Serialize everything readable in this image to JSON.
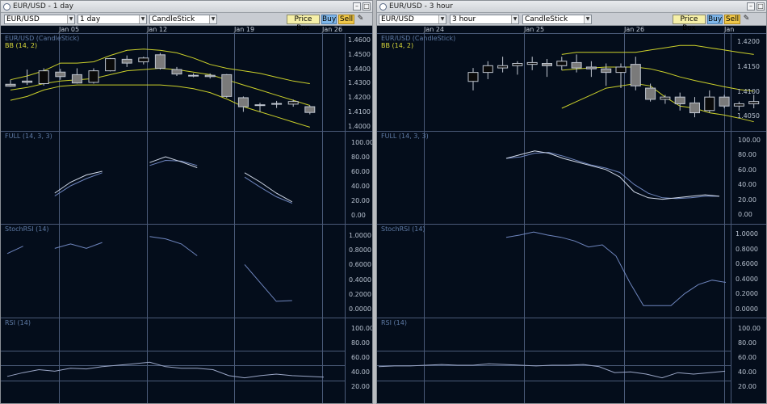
{
  "colors": {
    "bg": "#040d1b",
    "grid": "#4a5a78",
    "bb": "#cbd02a",
    "stoch_k": "#d0d8e8",
    "stoch_d": "#6f86bf",
    "rsi": "#9aa6c6",
    "bull": "#0a0a0a",
    "bear": "#7a7a7a",
    "wick": "#c0c6d0"
  },
  "left": {
    "title": "EUR/USD - 1 day",
    "symbol": "EUR/USD",
    "interval": "1 day",
    "chart_type": "CandleStick",
    "buttons": {
      "pricebox": "Price Box",
      "buy": "Buy",
      "sell": "Sell"
    },
    "dates": [
      "Jan 05",
      "Jan 12",
      "Jan 19",
      "Jan 26"
    ],
    "price_label": "EUR/USD (CandleStick)",
    "bb_label": "BB (14, 2)",
    "price_ticks": [
      "1.4600",
      "1.4500",
      "1.4400",
      "1.4300",
      "1.4200",
      "1.4100",
      "1.4000"
    ],
    "full_label": "FULL (14, 3, 3)",
    "full_ticks": [
      "100.00",
      "80.00",
      "60.00",
      "40.00",
      "20.00",
      "0.00"
    ],
    "stochrsi_label": "StochRSI (14)",
    "stochrsi_ticks": [
      "1.0000",
      "0.8000",
      "0.6000",
      "0.4000",
      "0.2000",
      "0.0000"
    ],
    "rsi_label": "RSI (14)",
    "rsi_ticks": [
      "100.00",
      "80.00",
      "60.00",
      "40.00",
      "20.00"
    ]
  },
  "right": {
    "title": "EUR/USD - 3 hour",
    "symbol": "EUR/USD",
    "interval": "3 hour",
    "chart_type": "CandleStick",
    "buttons": {
      "pricebox": "Price Box",
      "buy": "Buy",
      "sell": "Sell"
    },
    "dates": [
      "Jan 24",
      "Jan 25",
      "Jan 26",
      "Jan"
    ],
    "price_label": "EUR/USD (CandleStick)",
    "bb_label": "BB (14, 2)",
    "price_ticks": [
      "1.4200",
      "1.4150",
      "1.4100",
      "1.4050"
    ],
    "full_label": "FULL (14, 3, 3)",
    "full_ticks": [
      "100.00",
      "80.00",
      "60.00",
      "40.00",
      "20.00",
      "0.00"
    ],
    "stochrsi_label": "StochRSI (14)",
    "stochrsi_ticks": [
      "1.0000",
      "0.8000",
      "0.6000",
      "0.4000",
      "0.2000",
      "0.0000"
    ],
    "rsi_label": "RSI (14)",
    "rsi_ticks": [
      "100.00",
      "80.00",
      "60.00",
      "40.00",
      "20.00"
    ]
  },
  "chart_data": [
    {
      "type": "candlestick",
      "title": "EUR/USD (CandleStick)",
      "interval": "1 day",
      "ylim": [
        1.395,
        1.465
      ],
      "x_labels": [
        "Jan 05",
        "Jan 12",
        "Jan 19",
        "Jan 26"
      ],
      "candles": [
        {
          "o": 1.4295,
          "h": 1.433,
          "l": 1.4275,
          "c": 1.428
        },
        {
          "o": 1.432,
          "h": 1.441,
          "l": 1.429,
          "c": 1.431
        },
        {
          "o": 1.43,
          "h": 1.442,
          "l": 1.4285,
          "c": 1.44
        },
        {
          "o": 1.439,
          "h": 1.4415,
          "l": 1.433,
          "c": 1.4355
        },
        {
          "o": 1.437,
          "h": 1.442,
          "l": 1.43,
          "c": 1.4305
        },
        {
          "o": 1.431,
          "h": 1.442,
          "l": 1.43,
          "c": 1.44
        },
        {
          "o": 1.44,
          "h": 1.45,
          "l": 1.4395,
          "c": 1.4495
        },
        {
          "o": 1.449,
          "h": 1.452,
          "l": 1.443,
          "c": 1.446
        },
        {
          "o": 1.447,
          "h": 1.451,
          "l": 1.445,
          "c": 1.45
        },
        {
          "o": 1.4525,
          "h": 1.454,
          "l": 1.441,
          "c": 1.442
        },
        {
          "o": 1.441,
          "h": 1.443,
          "l": 1.436,
          "c": 1.4375
        },
        {
          "o": 1.4365,
          "h": 1.438,
          "l": 1.435,
          "c": 1.436
        },
        {
          "o": 1.4365,
          "h": 1.438,
          "l": 1.434,
          "c": 1.4355
        },
        {
          "o": 1.437,
          "h": 1.4375,
          "l": 1.419,
          "c": 1.42
        },
        {
          "o": 1.419,
          "h": 1.42,
          "l": 1.408,
          "c": 1.412
        },
        {
          "o": 1.413,
          "h": 1.415,
          "l": 1.408,
          "c": 1.4135
        },
        {
          "o": 1.4145,
          "h": 1.4165,
          "l": 1.411,
          "c": 1.414
        },
        {
          "o": 1.414,
          "h": 1.4175,
          "l": 1.412,
          "c": 1.416
        },
        {
          "o": 1.412,
          "h": 1.413,
          "l": 1.406,
          "c": 1.4075
        }
      ],
      "bb_upper": [
        1.433,
        1.436,
        1.44,
        1.446,
        1.446,
        1.447,
        1.452,
        1.456,
        1.457,
        1.456,
        1.454,
        1.45,
        1.445,
        1.442,
        1.44,
        1.438,
        1.435,
        1.432,
        1.43
      ],
      "bb_mid": [
        1.425,
        1.427,
        1.43,
        1.432,
        1.433,
        1.434,
        1.437,
        1.44,
        1.441,
        1.442,
        1.441,
        1.439,
        1.437,
        1.433,
        1.429,
        1.425,
        1.421,
        1.417,
        1.413
      ],
      "bb_lower": [
        1.417,
        1.42,
        1.425,
        1.428,
        1.429,
        1.429,
        1.429,
        1.429,
        1.429,
        1.429,
        1.428,
        1.426,
        1.423,
        1.418,
        1.412,
        1.408,
        1.404,
        1.4,
        1.396
      ]
    },
    {
      "type": "line",
      "title": "FULL (14, 3, 3)",
      "interval": "1 day",
      "ylim": [
        0,
        100
      ],
      "series": [
        {
          "name": "%K",
          "values": [
            24,
            null,
            null,
            30,
            45,
            55,
            60,
            null,
            null,
            72,
            80,
            73,
            65,
            null,
            null,
            58,
            45,
            30,
            18,
            null,
            18
          ]
        },
        {
          "name": "%D",
          "values": [
            24,
            null,
            null,
            26,
            40,
            50,
            58,
            null,
            null,
            68,
            75,
            74,
            68,
            null,
            null,
            52,
            38,
            25,
            16,
            null,
            17
          ]
        }
      ]
    },
    {
      "type": "line",
      "title": "StochRSI (14)",
      "interval": "1 day",
      "ylim": [
        0,
        1
      ],
      "series": [
        {
          "name": "StochRSI",
          "values": [
            0.75,
            0.85,
            null,
            0.82,
            0.88,
            0.82,
            0.9,
            null,
            null,
            0.98,
            0.95,
            0.88,
            0.72,
            null,
            null,
            0.6,
            0.35,
            0.1,
            0.11,
            null,
            0.1
          ]
        }
      ]
    },
    {
      "type": "line",
      "title": "RSI (14)",
      "interval": "1 day",
      "ylim": [
        0,
        100
      ],
      "series": [
        {
          "name": "RSI",
          "values": [
            35,
            40,
            44,
            42,
            46,
            45,
            48,
            50,
            52,
            54,
            48,
            46,
            46,
            44,
            36,
            33,
            36,
            38,
            36,
            35,
            34
          ]
        }
      ]
    },
    {
      "type": "candlestick",
      "title": "EUR/USD (CandleStick)",
      "interval": "3 hour",
      "ylim": [
        1.4025,
        1.4225
      ],
      "x_labels": [
        "Jan 24",
        "Jan 25",
        "Jan 26",
        "Jan"
      ],
      "candles": [
        {
          "o": 1.413,
          "h": 1.416,
          "l": 1.411,
          "c": 1.415
        },
        {
          "o": 1.415,
          "h": 1.4175,
          "l": 1.4135,
          "c": 1.4165
        },
        {
          "o": 1.416,
          "h": 1.4185,
          "l": 1.415,
          "c": 1.4165
        },
        {
          "o": 1.4165,
          "h": 1.4175,
          "l": 1.4145,
          "c": 1.417
        },
        {
          "o": 1.4168,
          "h": 1.4185,
          "l": 1.4155,
          "c": 1.4172
        },
        {
          "o": 1.417,
          "h": 1.418,
          "l": 1.414,
          "c": 1.4165
        },
        {
          "o": 1.4165,
          "h": 1.4185,
          "l": 1.4155,
          "c": 1.4175
        },
        {
          "o": 1.4172,
          "h": 1.419,
          "l": 1.415,
          "c": 1.416
        },
        {
          "o": 1.4162,
          "h": 1.4175,
          "l": 1.414,
          "c": 1.4158
        },
        {
          "o": 1.4158,
          "h": 1.417,
          "l": 1.412,
          "c": 1.415
        },
        {
          "o": 1.415,
          "h": 1.417,
          "l": 1.4115,
          "c": 1.4162
        },
        {
          "o": 1.4168,
          "h": 1.4185,
          "l": 1.411,
          "c": 1.412
        },
        {
          "o": 1.4115,
          "h": 1.4125,
          "l": 1.4085,
          "c": 1.409
        },
        {
          "o": 1.409,
          "h": 1.41,
          "l": 1.408,
          "c": 1.4095
        },
        {
          "o": 1.4095,
          "h": 1.4105,
          "l": 1.4065,
          "c": 1.408
        },
        {
          "o": 1.4082,
          "h": 1.4095,
          "l": 1.405,
          "c": 1.406
        },
        {
          "o": 1.4065,
          "h": 1.411,
          "l": 1.406,
          "c": 1.4095
        },
        {
          "o": 1.4095,
          "h": 1.41,
          "l": 1.407,
          "c": 1.4075
        },
        {
          "o": 1.4075,
          "h": 1.4085,
          "l": 1.4065,
          "c": 1.408
        },
        {
          "o": 1.408,
          "h": 1.41,
          "l": 1.407,
          "c": 1.4085
        }
      ],
      "bb_upper": [
        null,
        null,
        null,
        null,
        null,
        null,
        1.419,
        1.4195,
        1.4195,
        1.4195,
        1.4195,
        1.4195,
        1.42,
        1.4205,
        1.421,
        1.421,
        1.4205,
        1.42,
        1.4195,
        1.419
      ],
      "bb_mid": [
        null,
        null,
        null,
        null,
        null,
        null,
        1.4155,
        1.4158,
        1.416,
        1.4162,
        1.4162,
        1.4162,
        1.4158,
        1.415,
        1.414,
        1.4132,
        1.4125,
        1.4118,
        1.4112,
        1.4108
      ],
      "bb_lower": [
        null,
        null,
        null,
        null,
        null,
        null,
        1.407,
        1.4085,
        1.41,
        1.4115,
        1.412,
        1.4125,
        1.412,
        1.4095,
        1.4075,
        1.407,
        1.406,
        1.4055,
        1.4048,
        1.404
      ]
    },
    {
      "type": "line",
      "title": "FULL (14, 3, 3)",
      "interval": "3 hour",
      "ylim": [
        0,
        100
      ],
      "series": [
        {
          "name": "%K",
          "values": [
            75,
            80,
            85,
            82,
            75,
            70,
            65,
            60,
            50,
            30,
            22,
            20,
            22,
            24,
            26,
            24
          ]
        },
        {
          "name": "%D",
          "values": [
            75,
            77,
            82,
            83,
            78,
            72,
            66,
            62,
            56,
            40,
            28,
            22,
            21,
            22,
            24,
            24
          ]
        }
      ]
    },
    {
      "type": "line",
      "title": "StochRSI (14)",
      "interval": "3 hour",
      "ylim": [
        0,
        1
      ],
      "series": [
        {
          "name": "StochRSI",
          "values": [
            0.95,
            0.98,
            1.02,
            0.98,
            0.95,
            0.9,
            0.82,
            0.85,
            0.7,
            0.35,
            0.04,
            0.04,
            0.04,
            0.2,
            0.32,
            0.38,
            0.35
          ]
        }
      ]
    },
    {
      "type": "line",
      "title": "RSI (14)",
      "interval": "3 hour",
      "ylim": [
        0,
        100
      ],
      "series": [
        {
          "name": "RSI",
          "values": [
            48,
            49,
            49,
            50,
            51,
            50,
            50,
            52,
            51,
            50,
            49,
            50,
            50,
            51,
            48,
            40,
            41,
            38,
            33,
            40,
            38,
            40,
            42
          ]
        }
      ]
    }
  ]
}
